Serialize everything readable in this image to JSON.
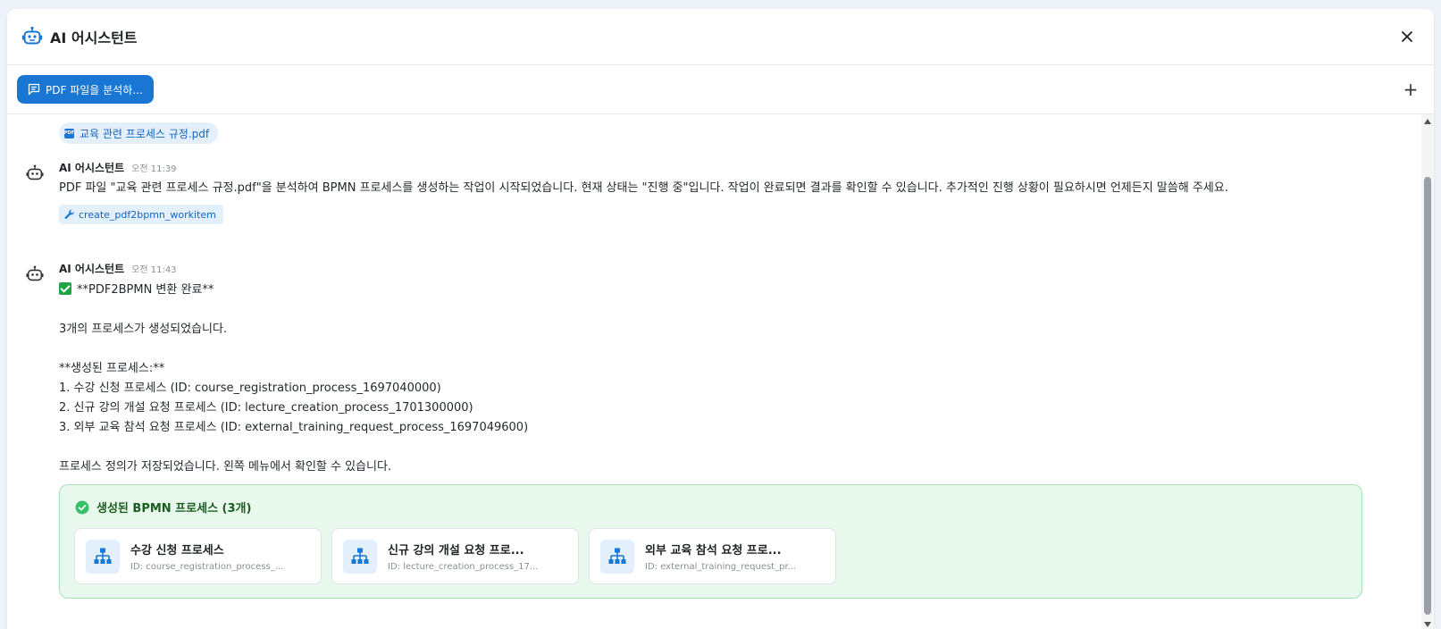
{
  "header": {
    "title": "AI 어시스턴트",
    "icon": "robot-icon"
  },
  "toolbar": {
    "session_label": "PDF 파일을 분석하...",
    "new_chat_symbol": "+"
  },
  "attachment": {
    "filename": "교육 관련 프로세스 규정.pdf",
    "type_label": "PDF"
  },
  "messages": [
    {
      "author": "AI 어시스턴트",
      "time": "오전 11:39",
      "text": "PDF 파일 \"교육 관련 프로세스 규정.pdf\"을 분석하여 BPMN 프로세스를 생성하는 작업이 시작되었습니다. 현재 상태는 \"진행 중\"입니다. 작업이 완료되면 결과를 확인할 수 있습니다. 추가적인 진행 상황이 필요하시면 언제든지 말씀해 주세요.",
      "tool": "create_pdf2bpmn_workitem"
    },
    {
      "author": "AI 어시스턴트",
      "time": "오전 11:43",
      "heading": "**PDF2BPMN 변환 완료**",
      "lines": [
        "",
        "3개의 프로세스가 생성되었습니다.",
        "",
        "**생성된 프로세스:**",
        "1. 수강 신청 프로세스 (ID: course_registration_process_1697040000)",
        "2. 신규 강의 개설 요청 프로세스 (ID: lecture_creation_process_1701300000)",
        "3. 외부 교육 참석 요청 프로세스 (ID: external_training_request_process_1697049600)",
        "",
        "프로세스 정의가 저장되었습니다. 왼쪽 메뉴에서 확인할 수 있습니다."
      ]
    }
  ],
  "results": {
    "title": "생성된 BPMN 프로세스 (3개)",
    "cards": [
      {
        "name": "수강 신청 프로세스",
        "id": "ID: course_registration_process_..."
      },
      {
        "name": "신규 강의 개설 요청 프로...",
        "id": "ID: lecture_creation_process_17..."
      },
      {
        "name": "외부 교육 참석 요청 프로...",
        "id": "ID: external_training_request_pr..."
      }
    ]
  },
  "colors": {
    "accent": "#1976d2",
    "success": "#1b5e20",
    "success_bg": "#e9f8ed"
  }
}
